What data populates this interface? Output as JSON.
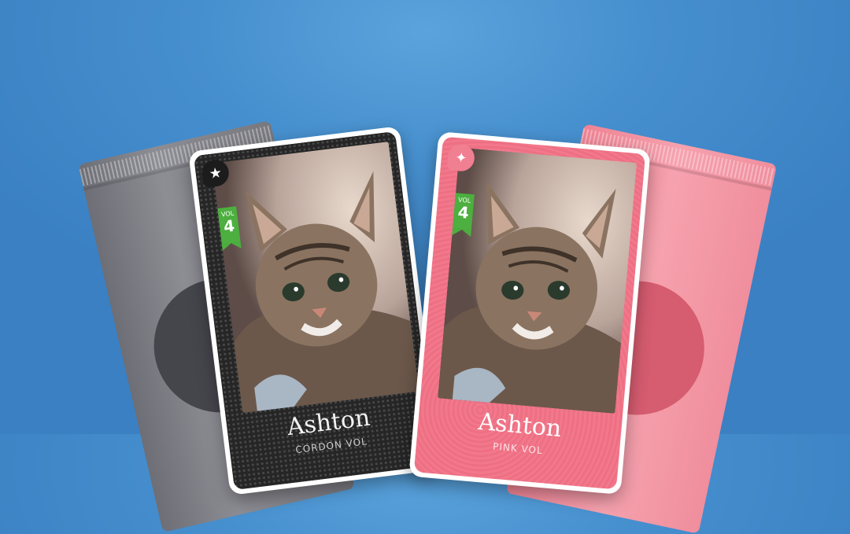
{
  "packs": [
    {
      "name": "gray-pack",
      "color": "#8d8d94"
    },
    {
      "name": "pink-pack",
      "color": "#f6a2ae"
    }
  ],
  "cards": [
    {
      "id": "dark",
      "badge_icon": "star-icon",
      "badge_glyph": "★",
      "volume_label": "VOL",
      "volume_number": "4",
      "name": "Ashton",
      "subtitle": "CORDON VOL",
      "frame_color": "#262626"
    },
    {
      "id": "pink",
      "badge_icon": "sparkle-icon",
      "badge_glyph": "✦",
      "volume_label": "VOL",
      "volume_number": "4",
      "name": "Ashton",
      "subtitle": "PINK VOL",
      "frame_color": "#f2788b"
    }
  ],
  "colors": {
    "background": "#468fce",
    "volume_ribbon": "#4caf3f"
  }
}
